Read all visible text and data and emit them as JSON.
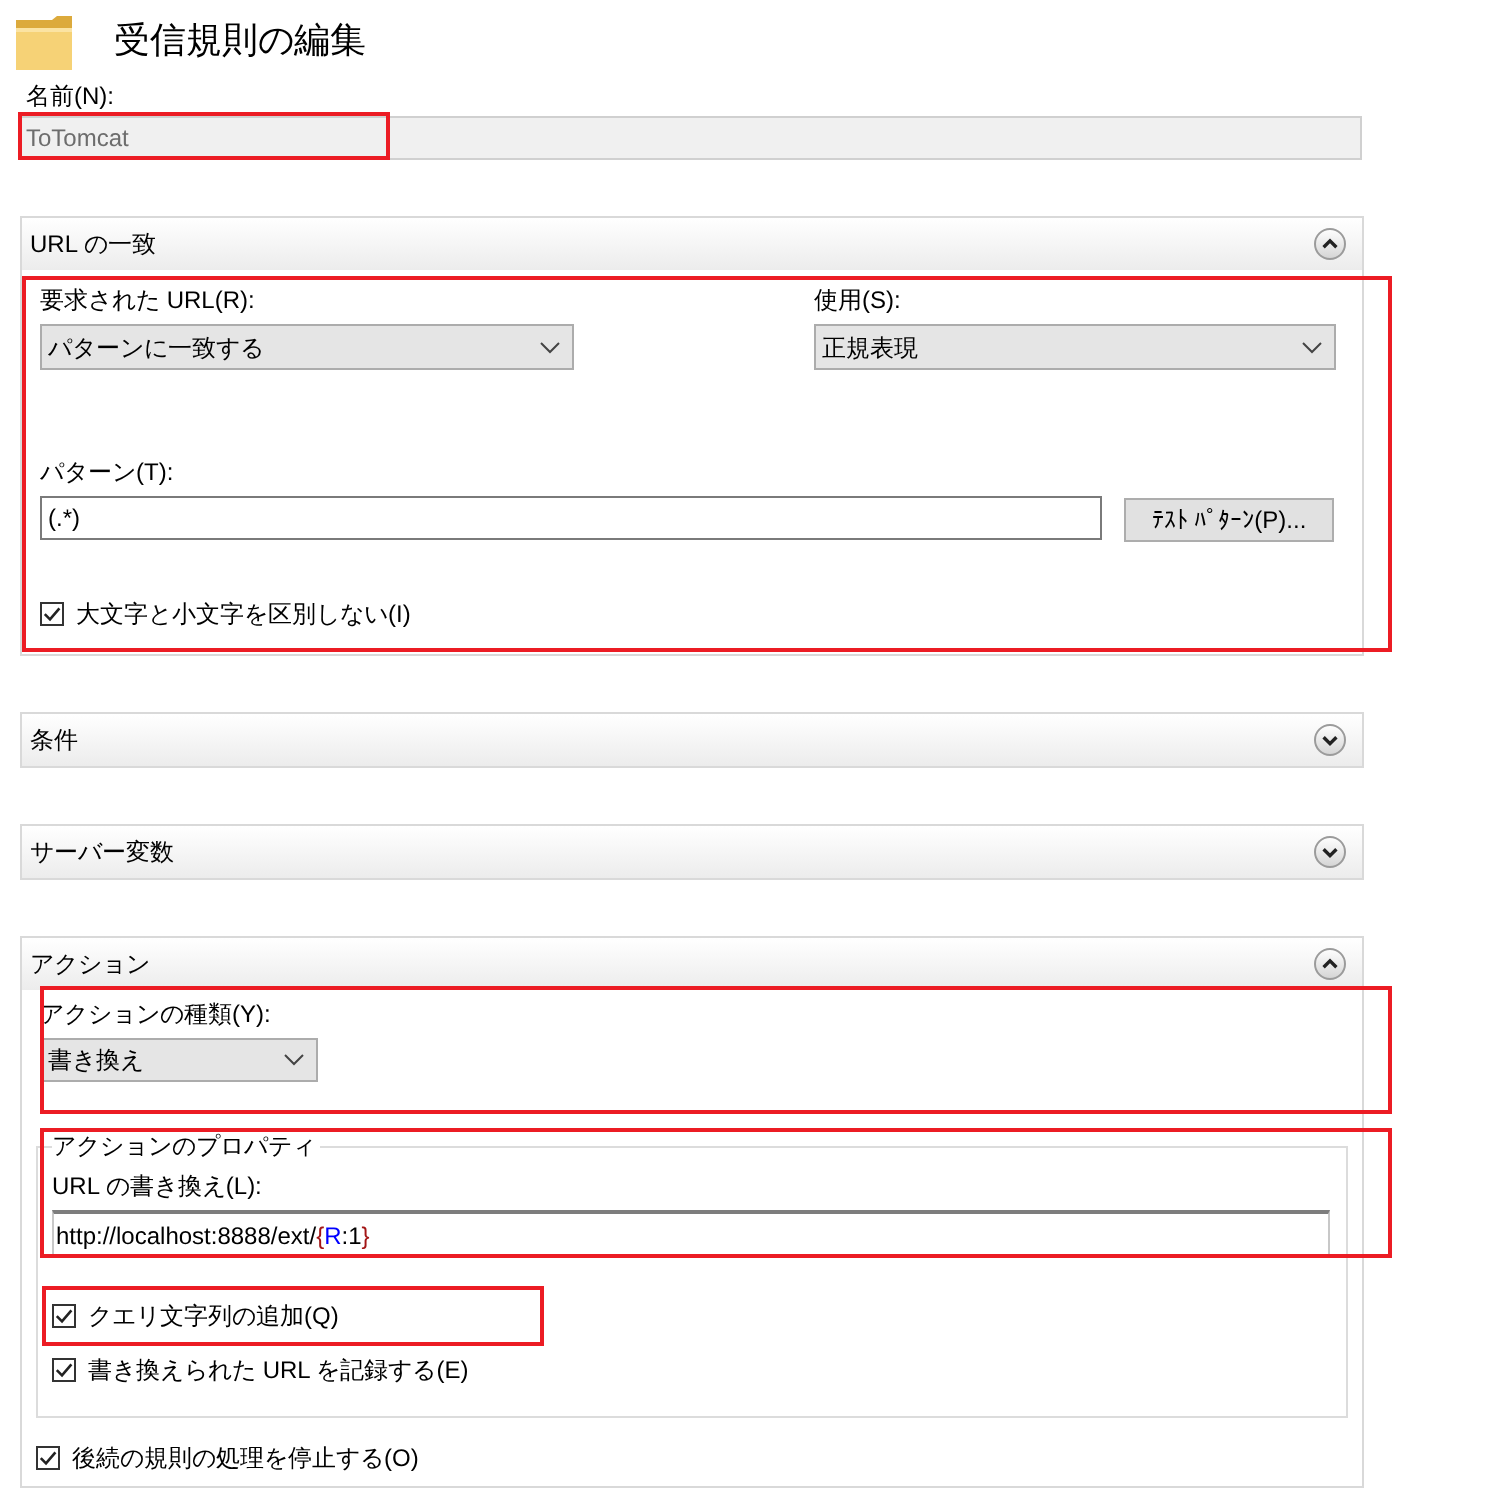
{
  "title": "受信規則の編集",
  "name_field": {
    "label": "名前(N):",
    "value": "ToTomcat",
    "disabled": true,
    "highlighted": true
  },
  "url_match": {
    "title": "URL の一致",
    "expanded": true,
    "highlighted": true,
    "requested_url": {
      "label": "要求された URL(R):",
      "value": "パターンに一致する"
    },
    "using": {
      "label": "使用(S):",
      "value": "正規表現"
    },
    "pattern": {
      "label": "パターン(T):",
      "value": "(.*)"
    },
    "test_button": "ﾃｽﾄ ﾊﾟﾀｰﾝ(P)...",
    "ignore_case": {
      "label": "大文字と小文字を区別しない(I)",
      "checked": true
    }
  },
  "conditions": {
    "title": "条件",
    "expanded": false
  },
  "server_variables": {
    "title": "サーバー変数",
    "expanded": false
  },
  "action": {
    "title": "アクション",
    "expanded": true,
    "action_type": {
      "label": "アクションの種類(Y):",
      "value": "書き換え",
      "highlighted": true
    },
    "properties": {
      "legend": "アクションのプロパティ",
      "rewrite_url": {
        "label": "URL の書き換え(L):",
        "highlighted": true,
        "tokens": [
          {
            "kind": "text",
            "text": "http://localhost:8888/ext/"
          },
          {
            "kind": "brace",
            "text": "{"
          },
          {
            "kind": "variable",
            "text": "R"
          },
          {
            "kind": "text",
            "text": ":1"
          },
          {
            "kind": "brace",
            "text": "}"
          }
        ]
      },
      "options": [
        {
          "label": "クエリ文字列の追加(Q)",
          "checked": true,
          "highlighted": true
        },
        {
          "label": "書き換えられた URL を記録する(E)",
          "checked": true,
          "highlighted": false
        }
      ]
    },
    "stop_processing": {
      "label": "後続の規則の処理を停止する(O)",
      "checked": true
    }
  }
}
